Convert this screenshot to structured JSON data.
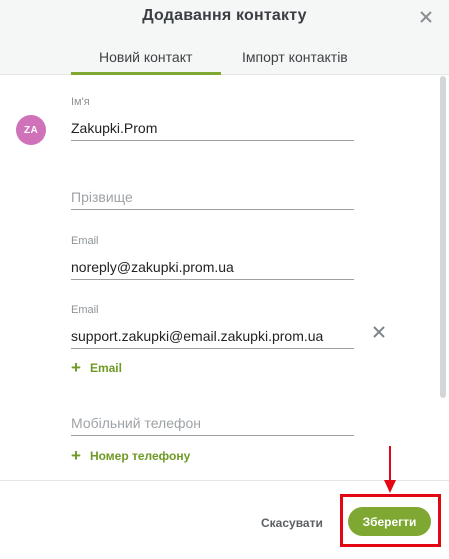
{
  "dialog": {
    "title": "Додавання контакту",
    "close_icon": "close-icon"
  },
  "tabs": [
    {
      "label": "Новий контакт",
      "active": true
    },
    {
      "label": "Імпорт контактів",
      "active": false
    }
  ],
  "contact": {
    "avatar_initials": "ZA",
    "avatar_color": "#d072b9",
    "name_label": "Ім'я",
    "name_value": "Zakupki.Prom",
    "surname_placeholder": "Прізвище",
    "emails": [
      {
        "label": "Email",
        "value": "noreply@zakupki.prom.ua"
      },
      {
        "label": "Email",
        "value": "support.zakupki@email.zakupki.prom.ua"
      }
    ],
    "add_email_label": "Email",
    "phone_placeholder": "Мобільний телефон",
    "add_phone_label": "Номер телефону"
  },
  "footer": {
    "cancel_label": "Скасувати",
    "save_label": "Зберегти"
  },
  "colors": {
    "accent": "#7ea832",
    "annotation": "#e30613"
  }
}
